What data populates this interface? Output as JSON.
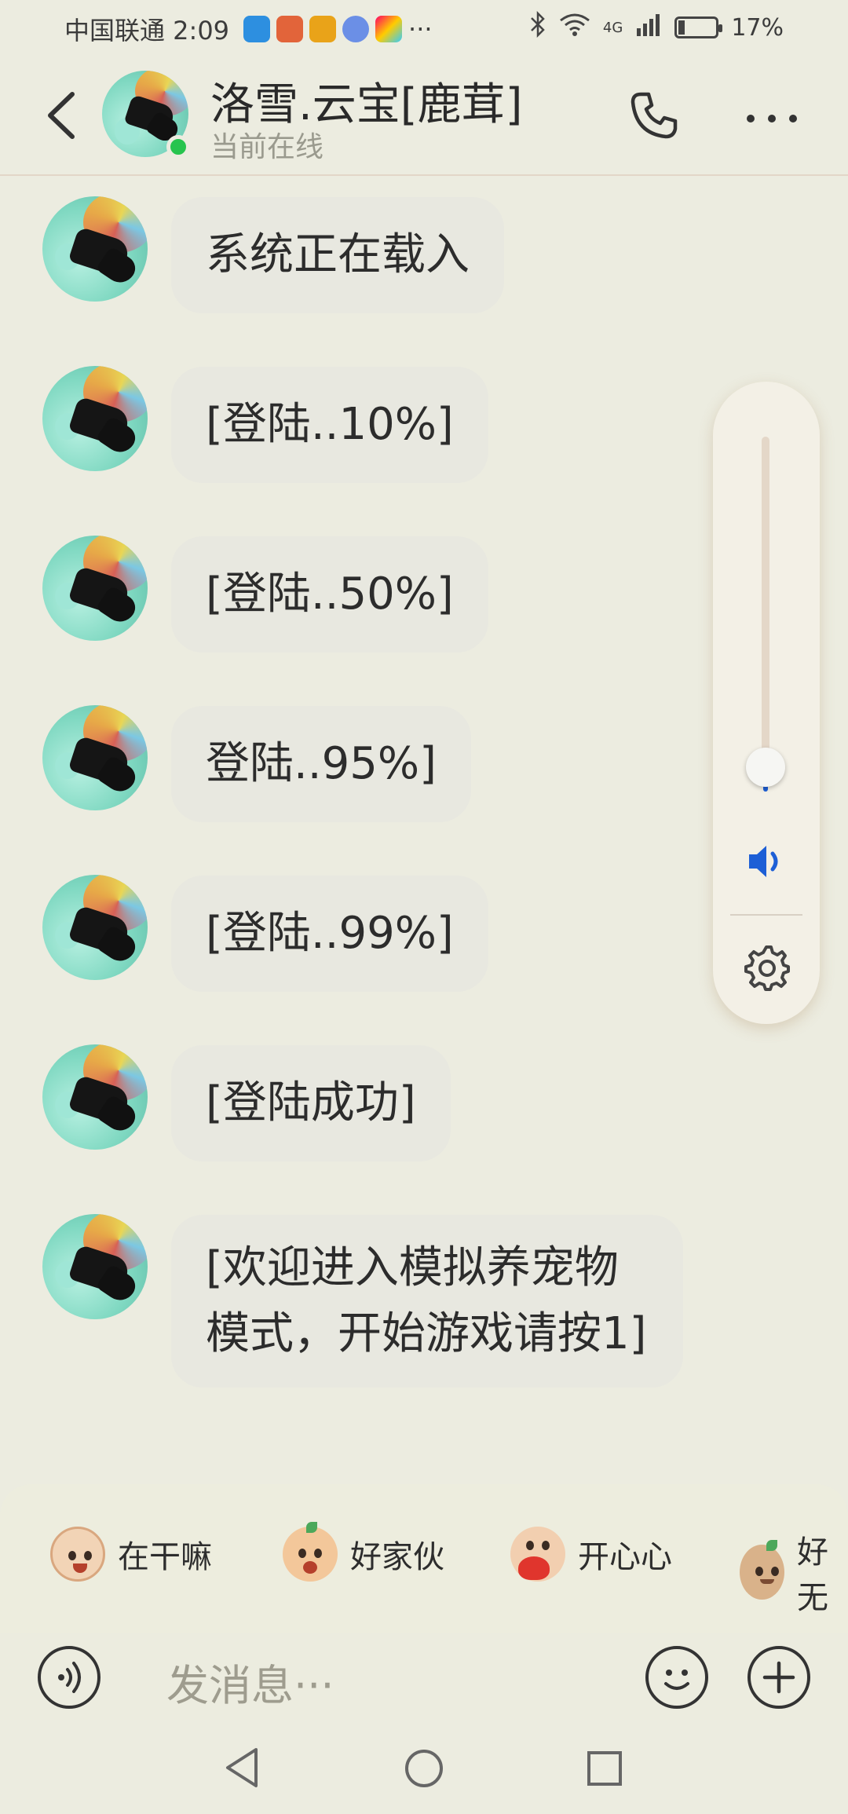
{
  "status_bar": {
    "carrier_time": "中国联通 2:09",
    "more": "···",
    "network": "4G",
    "battery": "17%",
    "battery_level": 0.17
  },
  "header": {
    "contact_name": "洛雪.云宝[鹿茸]",
    "presence": "当前在线",
    "colors": {
      "online": "#27c44e"
    }
  },
  "messages": [
    {
      "text": "系统正在载入"
    },
    {
      "text": "[登陆..10%]"
    },
    {
      "text": "[登陆..50%]"
    },
    {
      "text": "登陆..95%]"
    },
    {
      "text": "[登陆..99%]"
    },
    {
      "text": "[登陆成功]"
    },
    {
      "text": "[欢迎进入模拟养宠物模式，开始游戏请按1]"
    }
  ],
  "volume_panel": {
    "level": 0.0,
    "accent": "#1d5fd6"
  },
  "quick_replies": [
    {
      "label": "在干嘛"
    },
    {
      "label": "好家伙"
    },
    {
      "label": "开心心"
    },
    {
      "label": "好无"
    }
  ],
  "input": {
    "placeholder": "发消息···"
  }
}
